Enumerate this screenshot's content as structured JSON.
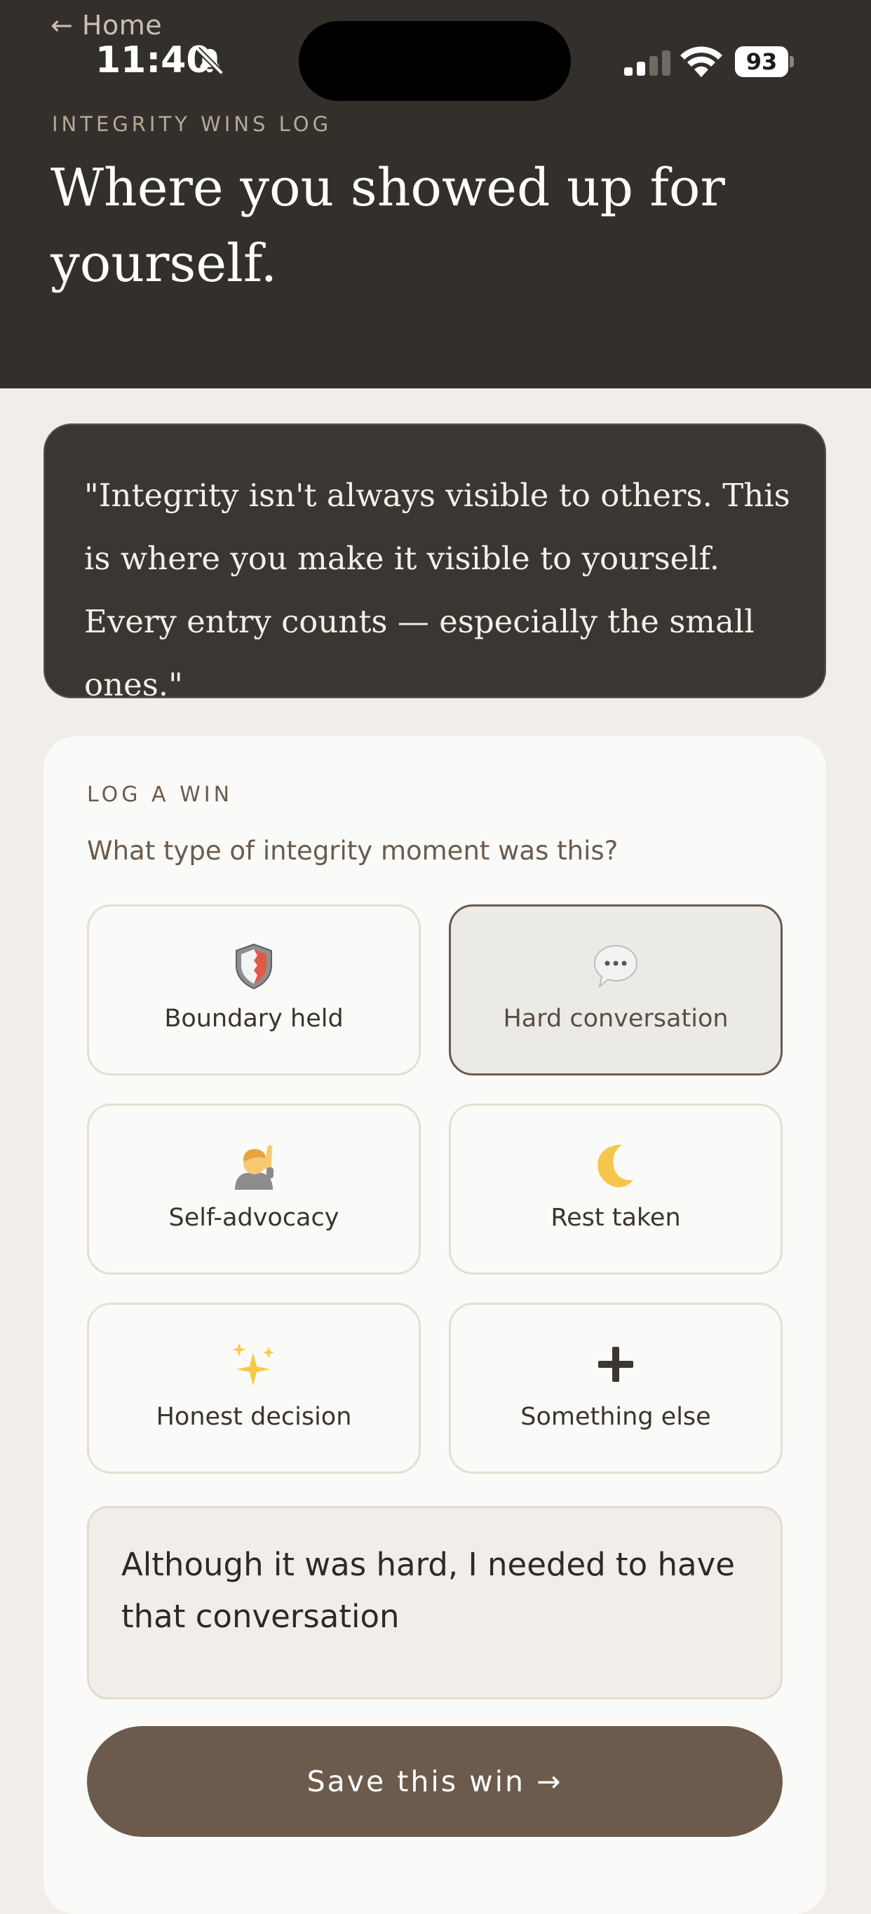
{
  "status_bar": {
    "back_label": "← Home",
    "time": "11:40",
    "battery": "93"
  },
  "header": {
    "eyebrow": "INTEGRITY WINS LOG",
    "title": "Where you showed up for yourself."
  },
  "quote": {
    "text": "\"Integrity isn't always visible to others. This is where you make it visible to yourself. Every entry counts — especially the small ones.\""
  },
  "log_form": {
    "section_label": "LOG A WIN",
    "question": "What type of integrity moment was this?",
    "options": [
      {
        "label": "Boundary held",
        "icon": "shield-icon",
        "selected": false
      },
      {
        "label": "Hard conversation",
        "icon": "speech-bubble-icon",
        "selected": true
      },
      {
        "label": "Self-advocacy",
        "icon": "raising-hand-icon",
        "selected": false
      },
      {
        "label": "Rest taken",
        "icon": "crescent-moon-icon",
        "selected": false
      },
      {
        "label": "Honest decision",
        "icon": "sparkles-icon",
        "selected": false
      },
      {
        "label": "Something else",
        "icon": "plus-icon",
        "selected": false
      }
    ],
    "note_value": "Although it was hard, I needed to have that conversation",
    "save_label": "Save this win →"
  },
  "colors": {
    "header_bg": "#33302B",
    "accent": "#6C5B4C",
    "page_bg": "#F1EEE9"
  }
}
